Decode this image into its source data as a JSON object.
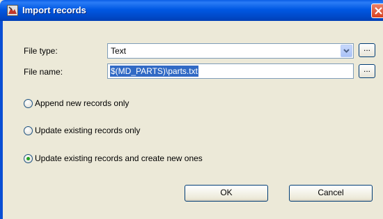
{
  "window": {
    "title": "Import records"
  },
  "file_type": {
    "label": "File type:",
    "value": "Text",
    "browse_label": "..."
  },
  "file_name": {
    "label": "File name:",
    "value": "$(MD_PARTS)\\parts.txt",
    "browse_label": "..."
  },
  "options": [
    {
      "label": "Append new records only",
      "selected": false
    },
    {
      "label": "Update existing records only",
      "selected": false
    },
    {
      "label": "Update existing records and create new ones",
      "selected": true
    }
  ],
  "buttons": {
    "ok": "OK",
    "cancel": "Cancel"
  },
  "colors": {
    "titlebar": "#0058e3",
    "dialog_bg": "#ece9d8",
    "selection": "#316ac5",
    "radio_dot": "#21a121",
    "close": "#d8401f"
  }
}
